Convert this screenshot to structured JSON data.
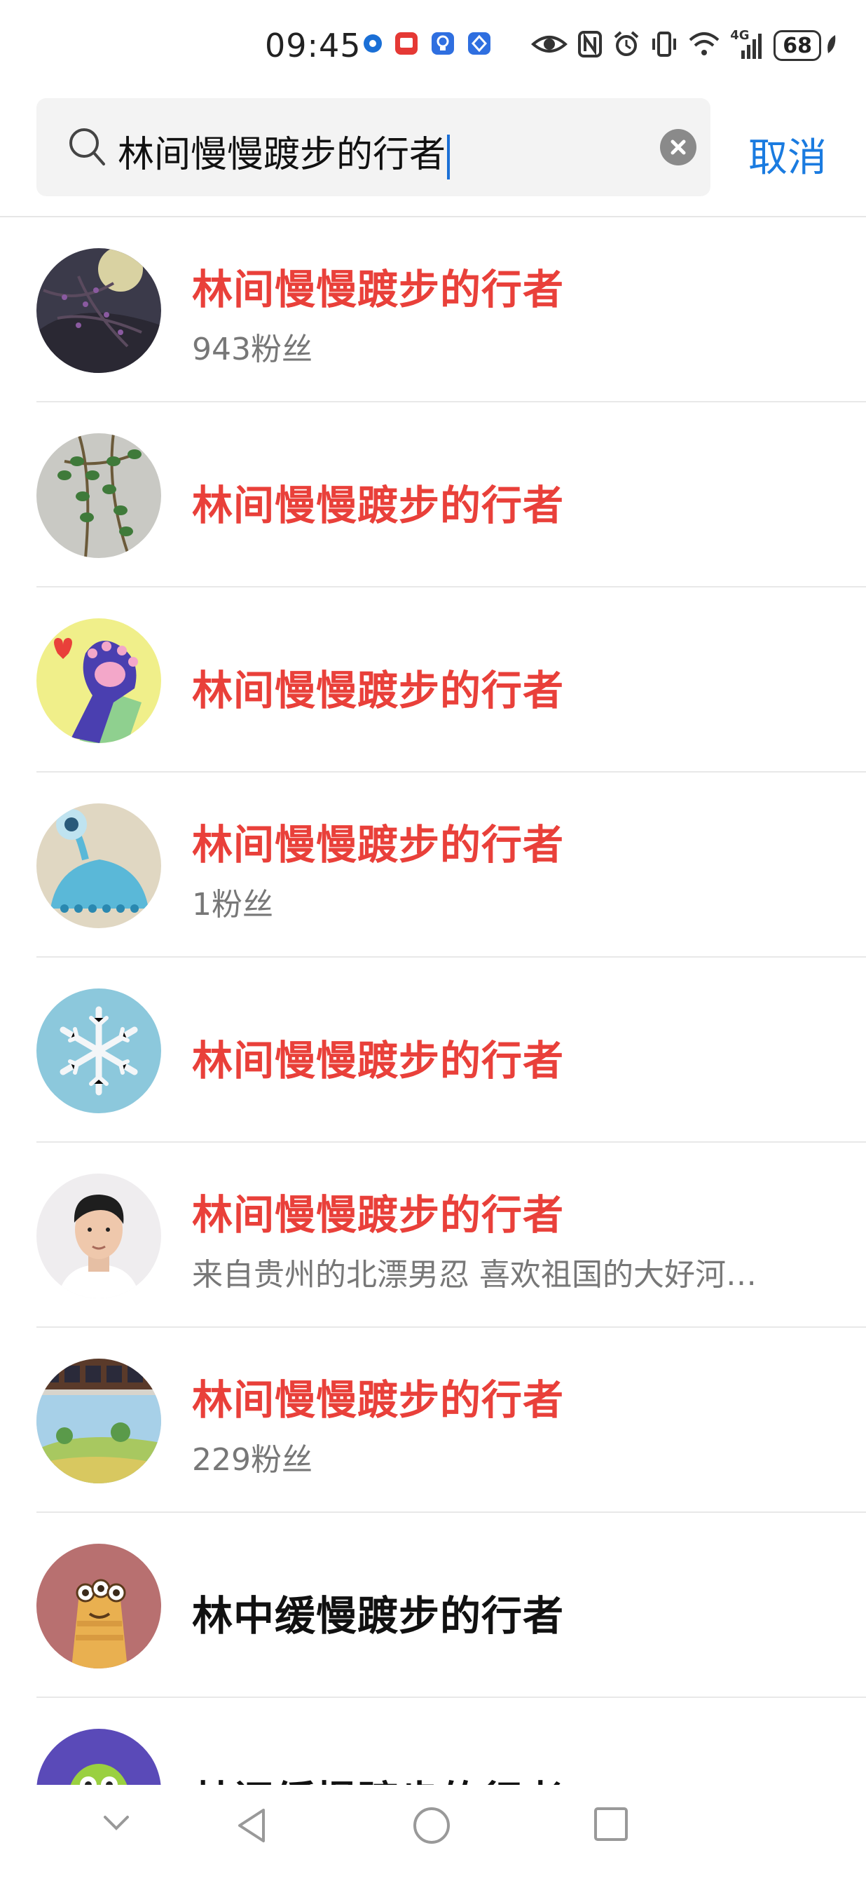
{
  "status_bar": {
    "time": "09:45",
    "network": "4G",
    "battery": "68",
    "icons": [
      "location-icon",
      "notes-icon",
      "tips-icon",
      "app-icon",
      "eye-icon",
      "nfc-icon",
      "alarm-icon",
      "vibrate-icon",
      "wifi-icon",
      "signal-icon",
      "leaf-icon"
    ]
  },
  "search": {
    "query": "林间慢慢踱步的行者",
    "cancel_label": "取消"
  },
  "results": [
    {
      "name": "林间慢慢踱步的行者",
      "sub": "943粉丝",
      "highlight": true
    },
    {
      "name": "林间慢慢踱步的行者",
      "sub": "",
      "highlight": true
    },
    {
      "name": "林间慢慢踱步的行者",
      "sub": "",
      "highlight": true
    },
    {
      "name": "林间慢慢踱步的行者",
      "sub": "1粉丝",
      "highlight": true
    },
    {
      "name": "林间慢慢踱步的行者",
      "sub": "",
      "highlight": true
    },
    {
      "name": "林间慢慢踱步的行者",
      "sub": "来自贵州的北漂男忍 喜欢祖国的大好河…",
      "highlight": true
    },
    {
      "name": "林间慢慢踱步的行者",
      "sub": "229粉丝",
      "highlight": true
    },
    {
      "name": "林中缓慢踱步的行者",
      "sub": "",
      "highlight": false
    },
    {
      "name": "林间缓慢踱步的行者",
      "sub": "",
      "highlight": false
    }
  ],
  "colors": {
    "highlight": "#e9403a",
    "accent": "#1a7be0"
  }
}
